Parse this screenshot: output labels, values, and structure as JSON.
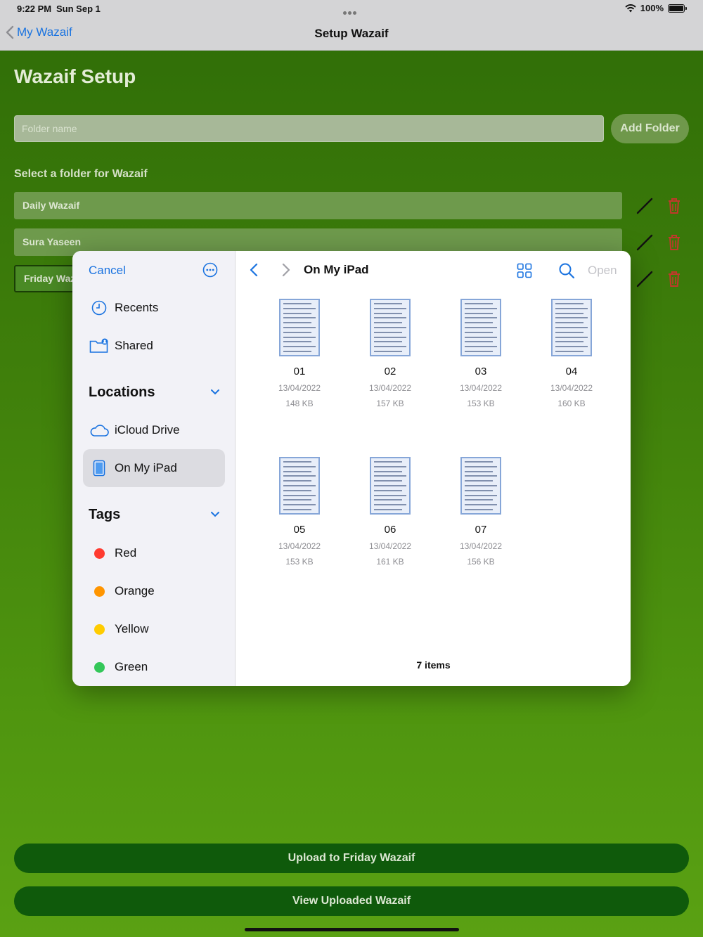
{
  "status": {
    "time": "9:22 PM",
    "date": "Sun Sep 1",
    "battery": "100%"
  },
  "nav": {
    "back_label": "My Wazaif",
    "title": "Setup Wazaif"
  },
  "page": {
    "title": "Wazaif Setup",
    "folder_input_placeholder": "Folder name",
    "add_folder_label": "Add Folder",
    "select_label": "Select a folder for Wazaif",
    "folders": [
      {
        "name": "Daily Wazaif",
        "selected": false
      },
      {
        "name": "Sura Yaseen",
        "selected": false
      },
      {
        "name": "Friday Waz",
        "selected": true
      }
    ],
    "upload_label": "Upload to Friday Wazaif",
    "view_label": "View Uploaded Wazaif",
    "colors": {
      "accent": "#0f5a0b",
      "delete": "#c0392b"
    }
  },
  "picker": {
    "cancel_label": "Cancel",
    "recents_label": "Recents",
    "shared_label": "Shared",
    "locations_heading": "Locations",
    "icloud_label": "iCloud Drive",
    "on_my_ipad_label": "On My iPad",
    "tags_heading": "Tags",
    "tags": [
      {
        "label": "Red",
        "color": "#ff3b30"
      },
      {
        "label": "Orange",
        "color": "#ff9500"
      },
      {
        "label": "Yellow",
        "color": "#ffcc00"
      },
      {
        "label": "Green",
        "color": "#34c759"
      }
    ],
    "location_title": "On My iPad",
    "open_label": "Open",
    "files": [
      {
        "name": "01",
        "date": "13/04/2022",
        "size": "148 KB"
      },
      {
        "name": "02",
        "date": "13/04/2022",
        "size": "157 KB"
      },
      {
        "name": "03",
        "date": "13/04/2022",
        "size": "153 KB"
      },
      {
        "name": "04",
        "date": "13/04/2022",
        "size": "160 KB"
      },
      {
        "name": "05",
        "date": "13/04/2022",
        "size": "153 KB"
      },
      {
        "name": "06",
        "date": "13/04/2022",
        "size": "161 KB"
      },
      {
        "name": "07",
        "date": "13/04/2022",
        "size": "156 KB"
      }
    ],
    "item_count": "7 items"
  }
}
